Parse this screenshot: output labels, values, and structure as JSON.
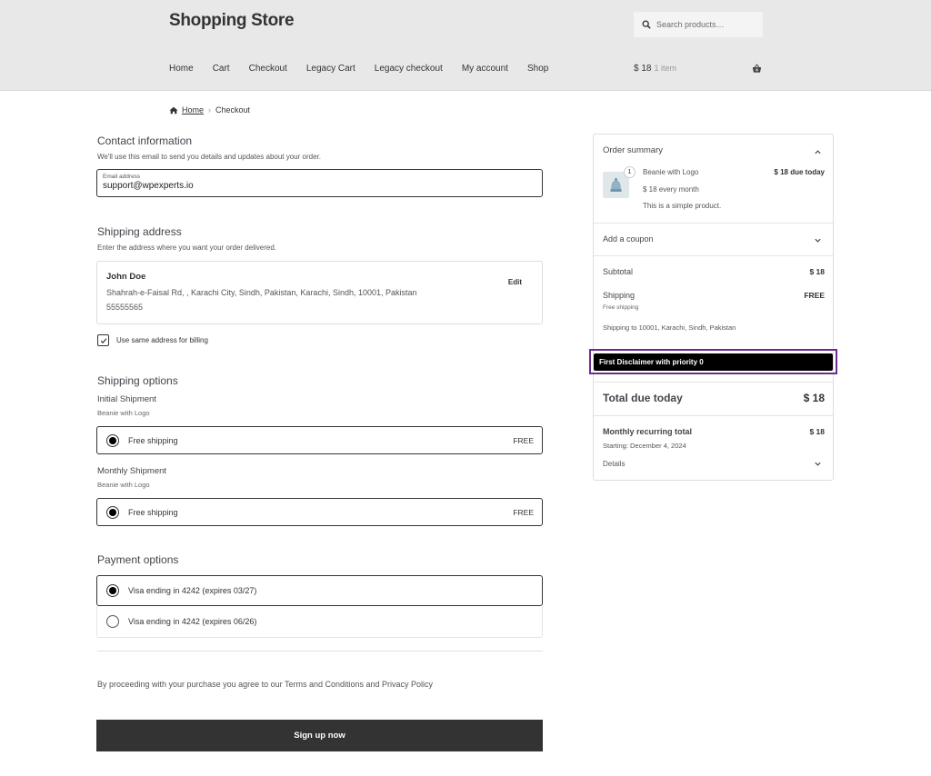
{
  "header": {
    "site_title": "Shopping Store",
    "search_placeholder": "Search products…",
    "nav": [
      "Home",
      "Cart",
      "Checkout",
      "Legacy Cart",
      "Legacy checkout",
      "My account",
      "Shop"
    ],
    "cart_total": "$ 18",
    "cart_count": "1 item"
  },
  "breadcrumb": {
    "home": "Home",
    "current": "Checkout"
  },
  "contact": {
    "title": "Contact information",
    "description": "We'll use this email to send you details and updates about your order.",
    "email_label": "Email address",
    "email_value": "support@wpexperts.io"
  },
  "shipping_address": {
    "title": "Shipping address",
    "description": "Enter the address where you want your order delivered.",
    "name": "John Doe",
    "address": "Shahrah-e-Faisal Rd, , Karachi City, Sindh, Pakistan, Karachi, Sindh, 10001, Pakistan",
    "phone": "55555565",
    "edit_label": "Edit",
    "billing_checkbox_label": "Use same address for billing",
    "billing_checked": true
  },
  "shipping_options": {
    "title": "Shipping options",
    "groups": [
      {
        "title": "Initial Shipment",
        "product": "Beanie with Logo",
        "option": "Free shipping",
        "price": "FREE"
      },
      {
        "title": "Monthly Shipment",
        "product": "Beanie with Logo",
        "option": "Free shipping",
        "price": "FREE"
      }
    ]
  },
  "payment": {
    "title": "Payment options",
    "methods": [
      {
        "label": "Visa ending in 4242 (expires 03/27)",
        "selected": true
      },
      {
        "label": "Visa ending in 4242 (expires 06/26)",
        "selected": false
      }
    ]
  },
  "terms": "By proceeding with your purchase you agree to our Terms and Conditions and Privacy Policy",
  "submit_label": "Sign up now",
  "summary": {
    "title": "Order summary",
    "product": {
      "quantity": "1",
      "name": "Beanie with Logo",
      "price": "$ 18 due today",
      "recurring": "$ 18 every month",
      "description": "This is a simple product."
    },
    "coupon_label": "Add a coupon",
    "subtotal_label": "Subtotal",
    "subtotal_value": "$ 18",
    "shipping_label": "Shipping",
    "shipping_value": "FREE",
    "shipping_method": "Free shipping",
    "shipping_to": "Shipping to 10001, Karachi, Sindh, Pakistan",
    "disclaimer": "First Disclaimer with priority 0",
    "total_label": "Total due today",
    "total_value": "$ 18",
    "recurring_label": "Monthly recurring total",
    "recurring_value": "$ 18",
    "recurring_start": "Starting: December 4, 2024",
    "details_label": "Details"
  },
  "colors": {
    "header_bg": "#e8e8e9",
    "button_bg": "#333333",
    "highlight_border": "#6a2c91"
  }
}
